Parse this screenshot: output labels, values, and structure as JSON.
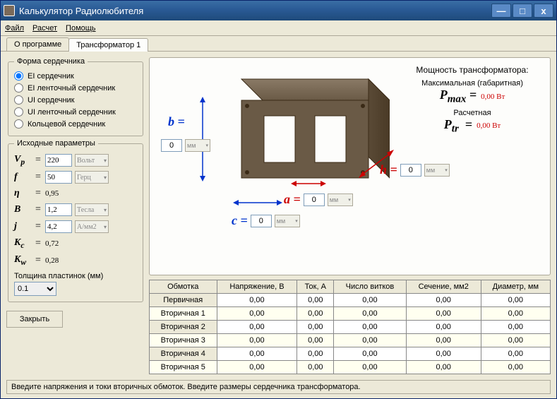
{
  "window": {
    "title": "Калькулятор Радиолюбителя"
  },
  "menu": {
    "file": "Файл",
    "calc": "Расчет",
    "help": "Помощь"
  },
  "tabs": {
    "about": "О программе",
    "trans": "Трансформатор 1"
  },
  "core_shape": {
    "legend": "Форма сердечника",
    "opt1": "EI сердечник",
    "opt2": "EI ленточный сердечник",
    "opt3": "UI сердечник",
    "opt4": "UI ленточный сердечник",
    "opt5": "Кольцевой сердечник"
  },
  "params": {
    "legend": "Исходные параметры",
    "vp": {
      "sym": "V",
      "sub": "p",
      "val": "220",
      "unit": "Вольт"
    },
    "f": {
      "sym": "f",
      "val": "50",
      "unit": "Герц"
    },
    "eta": {
      "sym": "η",
      "val": "0,95"
    },
    "b": {
      "sym": "B",
      "val": "1,2",
      "unit": "Тесла"
    },
    "j": {
      "sym": "j",
      "val": "4,2",
      "unit": "А/мм2"
    },
    "kc": {
      "sym": "K",
      "sub": "c",
      "val": "0,72"
    },
    "kw": {
      "sym": "K",
      "sub": "w",
      "val": "0,28"
    }
  },
  "thickness": {
    "label": "Толщина пластинок (мм)",
    "val": "0.1"
  },
  "close": "Закрыть",
  "dims": {
    "a": {
      "label": "a =",
      "val": "0",
      "unit": "мм"
    },
    "b": {
      "label": "b =",
      "val": "0",
      "unit": "мм"
    },
    "c": {
      "label": "c =",
      "val": "0",
      "unit": "мм"
    },
    "h": {
      "label": "h =",
      "val": "0",
      "unit": "мм"
    }
  },
  "power": {
    "title": "Мощность трансформатора:",
    "max_label": "Максимальная (габаритная)",
    "max_sym": "P",
    "max_sub": "max",
    "max_val": "0,00 Вт",
    "calc_label": "Расчетная",
    "calc_sym": "P",
    "calc_sub": "tr",
    "calc_val": "0,00 Вт"
  },
  "table": {
    "headers": [
      "Обмотка",
      "Напряжение, В",
      "Ток, А",
      "Число витков",
      "Сечение, мм2",
      "Диаметр, мм"
    ],
    "rows": [
      [
        "Первичная",
        "0,00",
        "0,00",
        "0,00",
        "0,00",
        "0,00"
      ],
      [
        "Вторичная 1",
        "0,00",
        "0,00",
        "0,00",
        "0,00",
        "0,00"
      ],
      [
        "Вторичная 2",
        "0,00",
        "0,00",
        "0,00",
        "0,00",
        "0,00"
      ],
      [
        "Вторичная 3",
        "0,00",
        "0,00",
        "0,00",
        "0,00",
        "0,00"
      ],
      [
        "Вторичная 4",
        "0,00",
        "0,00",
        "0,00",
        "0,00",
        "0,00"
      ],
      [
        "Вторичная 5",
        "0,00",
        "0,00",
        "0,00",
        "0,00",
        "0,00"
      ]
    ]
  },
  "status": "Введите напряжения и токи вторичных обмоток. Введите размеры сердечника трансформатора."
}
